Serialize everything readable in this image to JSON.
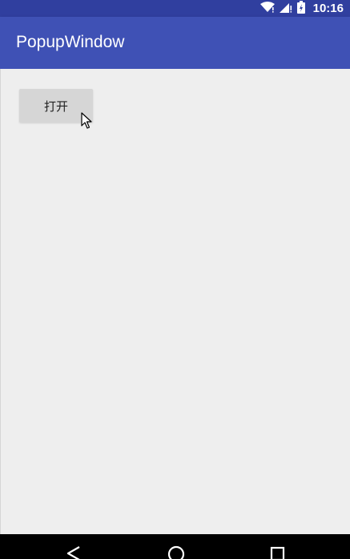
{
  "status_bar": {
    "time": "10:16",
    "icons": [
      "wifi-icon",
      "signal-icon",
      "battery-icon"
    ],
    "color": "#303f9f"
  },
  "app_bar": {
    "title": "PopupWindow",
    "color": "#3f51b5"
  },
  "main": {
    "open_button_label": "打开"
  },
  "nav_bar": {
    "icons": [
      "back-icon",
      "home-icon",
      "recents-icon"
    ]
  }
}
